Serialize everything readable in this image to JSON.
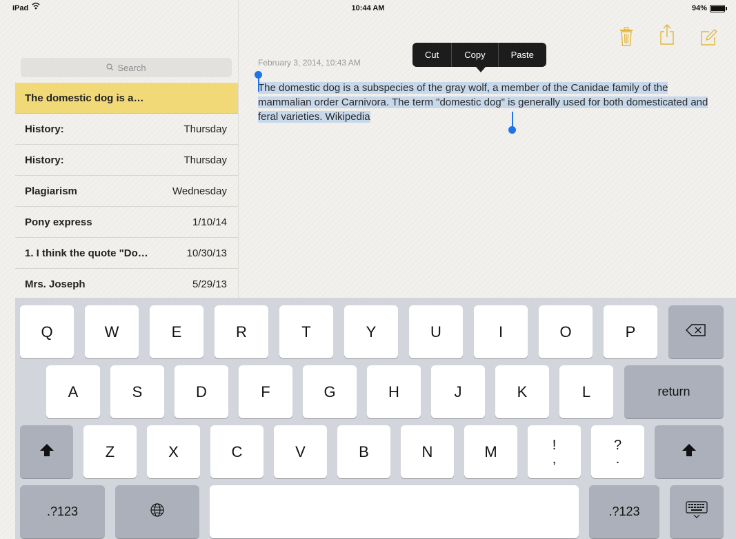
{
  "status_bar": {
    "carrier": "iPad",
    "time": "10:44 AM",
    "battery_percent": "94%",
    "battery_level": 0.94
  },
  "sidebar": {
    "search_placeholder": "Search",
    "notes": [
      {
        "title": "The domestic dog is a…",
        "date": "",
        "selected": true
      },
      {
        "title": "History:",
        "date": "Thursday"
      },
      {
        "title": "History:",
        "date": "Thursday"
      },
      {
        "title": "Plagiarism",
        "date": "Wednesday"
      },
      {
        "title": "Pony express",
        "date": "1/10/14"
      },
      {
        "title": "1. I think the quote \"Do…",
        "date": "10/30/13"
      },
      {
        "title": "Mrs. Joseph",
        "date": "5/29/13"
      }
    ]
  },
  "toolbar": {
    "icons": [
      "trash-icon",
      "share-icon",
      "compose-icon"
    ],
    "accent_color": "#e2b53a"
  },
  "note": {
    "date": "February 3, 2014, 10:43 AM",
    "body": "The domestic dog is a subspecies of the gray wolf, a member of the Canidae family of the mammalian order Carnivora. The term \"domestic dog\" is generally used for both domesticated and feral varieties. Wikipedia"
  },
  "edit_menu": {
    "items": [
      "Cut",
      "Copy",
      "Paste"
    ]
  },
  "keyboard": {
    "row1": [
      "Q",
      "W",
      "E",
      "R",
      "T",
      "Y",
      "U",
      "I",
      "O",
      "P"
    ],
    "row2": [
      "A",
      "S",
      "D",
      "F",
      "G",
      "H",
      "J",
      "K",
      "L"
    ],
    "row3": [
      "Z",
      "X",
      "C",
      "V",
      "B",
      "N",
      "M"
    ],
    "punct1": {
      "top": "!",
      "bottom": ","
    },
    "punct2": {
      "top": "?",
      "bottom": "."
    },
    "return_label": "return",
    "numbers_label": ".?123",
    "icons": [
      "backspace-icon",
      "shift-icon",
      "globe-icon",
      "keyboard-dismiss-icon"
    ]
  }
}
